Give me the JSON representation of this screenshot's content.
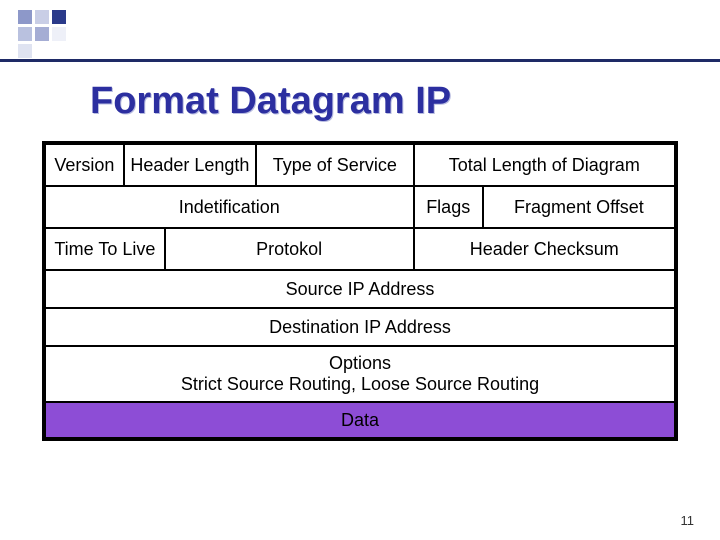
{
  "title": "Format Datagram IP",
  "rows": {
    "r1": {
      "version": "Version",
      "hlen": "Header Length",
      "tos": "Type of Service",
      "total": "Total Length of Diagram"
    },
    "r2": {
      "ident": "Indetification",
      "flags": "Flags",
      "fragoff": "Fragment Offset"
    },
    "r3": {
      "ttl": "Time To Live",
      "proto": "Protokol",
      "checksum": "Header Checksum"
    },
    "r4": {
      "src": "Source IP Address"
    },
    "r5": {
      "dst": "Destination IP Address"
    },
    "r6": {
      "options_l1": "Options",
      "options_l2": "Strict Source Routing, Loose Source Routing"
    },
    "r7": {
      "data": "Data"
    }
  },
  "page_number": "11"
}
